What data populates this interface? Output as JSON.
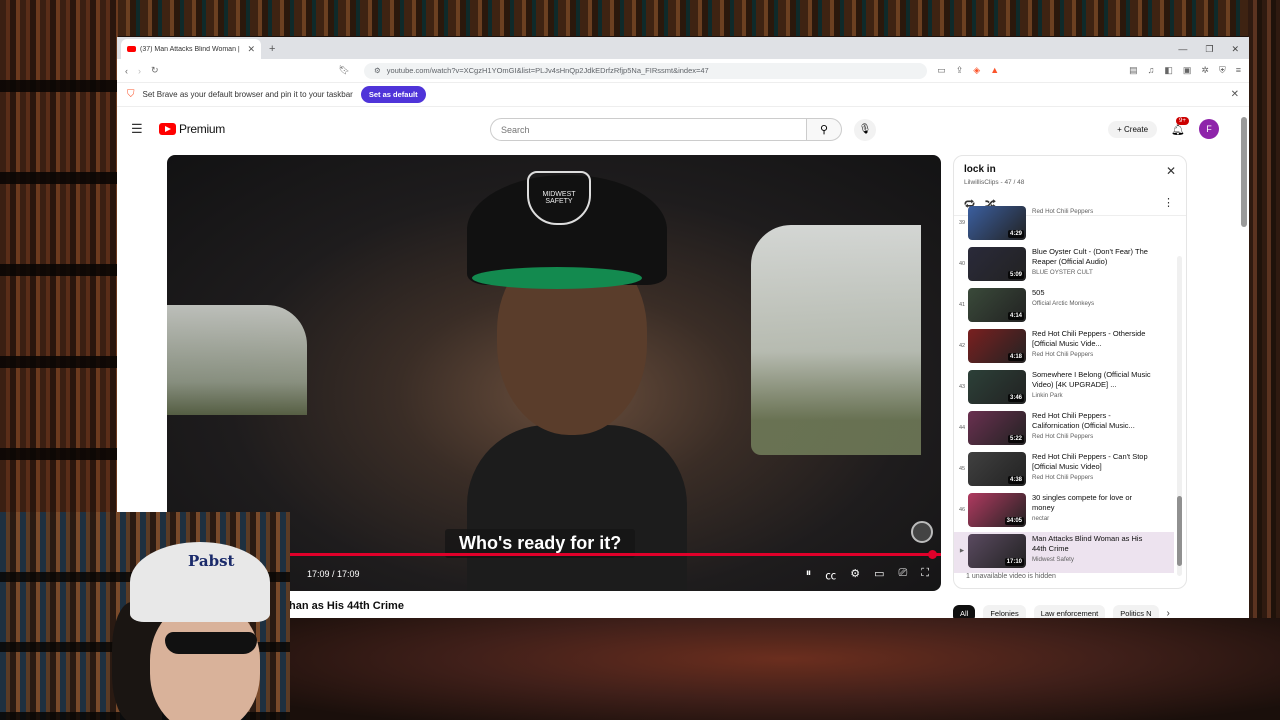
{
  "browser": {
    "tab_title": "(37) Man Attacks Blind Woman |",
    "url": "youtube.com/watch?v=XCgzH1YOmGI&list=PLJv4sHnQp2JdkEDrfzRfjp5Na_FIRssmt&index=47"
  },
  "infobar": {
    "message": "Set Brave as your default browser and pin it to your taskbar",
    "button": "Set as default"
  },
  "youtube": {
    "brand": "Premium",
    "search_placeholder": "Search",
    "create_label": "Create",
    "notif_count": "9+",
    "avatar_letter": "F"
  },
  "player": {
    "subtitle": "Who's ready for it?",
    "time": "17:09 / 17:09",
    "cap_text": "MIDWEST SAFETY",
    "progress": 1.0
  },
  "video_title_fragment": "han as His 44th Crime",
  "playlist": {
    "title": "lock in",
    "subtitle": "LilwillisClips - 47 / 48",
    "hidden_note": "1 unavailable video is hidden",
    "items": [
      {
        "index": "39",
        "title": "",
        "channel": "Red Hot Chili Peppers",
        "duration": "4:29",
        "color": "#3b5fa0"
      },
      {
        "index": "40",
        "title": "Blue Oyster Cult - (Don't Fear) The Reaper (Official Audio)",
        "channel": "BLUE OYSTER CULT",
        "duration": "5:09",
        "color": "#2a2a3a"
      },
      {
        "index": "41",
        "title": "505",
        "channel": "Official Arctic Monkeys",
        "duration": "4:14",
        "color": "#3a4a3a"
      },
      {
        "index": "42",
        "title": "Red Hot Chili Peppers - Otherside [Official Music Vide...",
        "channel": "Red Hot Chili Peppers",
        "duration": "4:18",
        "color": "#7a2020"
      },
      {
        "index": "43",
        "title": "Somewhere I Belong (Official Music Video) [4K UPGRADE] ...",
        "channel": "Linkin Park",
        "duration": "3:46",
        "color": "#2c4038"
      },
      {
        "index": "44",
        "title": "Red Hot Chili Peppers - Californication (Official Music...",
        "channel": "Red Hot Chili Peppers",
        "duration": "5:22",
        "color": "#6a3050"
      },
      {
        "index": "45",
        "title": "Red Hot Chili Peppers - Can't Stop [Official Music Video]",
        "channel": "Red Hot Chili Peppers",
        "duration": "4:38",
        "color": "#404040"
      },
      {
        "index": "46",
        "title": "30 singles compete for love or money",
        "channel": "nectar",
        "duration": "34:05",
        "color": "#b03a60"
      },
      {
        "index": "▶",
        "title": "Man Attacks Blind Woman as His 44th Crime",
        "channel": "Midwest Safety",
        "duration": "17:10",
        "color": "#5a4a60",
        "active": true
      }
    ]
  },
  "chips": [
    "All",
    "Felonies",
    "Law enforcement",
    "Politics N"
  ],
  "webcam": {
    "cap_text": "Pabst"
  }
}
